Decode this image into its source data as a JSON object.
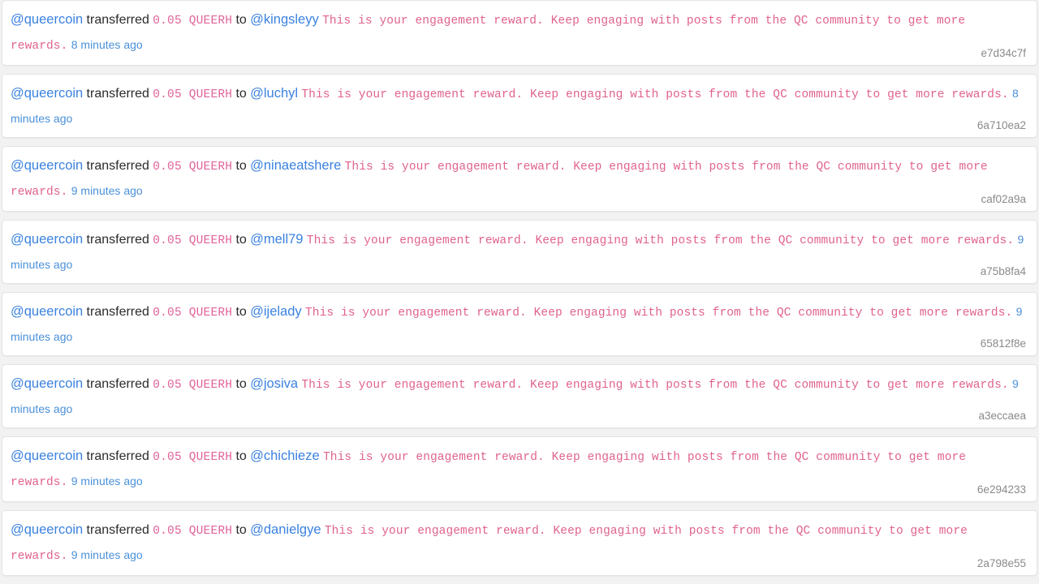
{
  "feed": {
    "sender": "@queercoin",
    "verb_transferred": "transferred",
    "verb_to": "to",
    "amount": "0.05 QUEERH",
    "memo": "This is your engagement reward. Keep engaging with posts from the QC community to get more rewards.",
    "colors": {
      "link": "#3b82e0",
      "memo": "#e0628f",
      "amount": "#e0639a",
      "timestamp": "#4a90d9",
      "txid": "#8a8a8a",
      "page_background": "#f2f2f2",
      "card_background": "#ffffff"
    },
    "transactions": [
      {
        "sender": "@queercoin",
        "verb_transferred": "transferred",
        "amount": "0.05 QUEERH",
        "verb_to": "to",
        "recipient": "@kingsleyy",
        "memo": "This is your engagement reward. Keep engaging with posts from the QC community to get more rewards.",
        "timestamp": "8 minutes ago",
        "txid": "e7d34c7f"
      },
      {
        "sender": "@queercoin",
        "verb_transferred": "transferred",
        "amount": "0.05 QUEERH",
        "verb_to": "to",
        "recipient": "@luchyl",
        "memo": "This is your engagement reward. Keep engaging with posts from the QC community to get more rewards.",
        "timestamp": "8 minutes ago",
        "txid": "6a710ea2"
      },
      {
        "sender": "@queercoin",
        "verb_transferred": "transferred",
        "amount": "0.05 QUEERH",
        "verb_to": "to",
        "recipient": "@ninaeatshere",
        "memo": "This is your engagement reward. Keep engaging with posts from the QC community to get more rewards.",
        "timestamp": "9 minutes ago",
        "txid": "caf02a9a"
      },
      {
        "sender": "@queercoin",
        "verb_transferred": "transferred",
        "amount": "0.05 QUEERH",
        "verb_to": "to",
        "recipient": "@mell79",
        "memo": "This is your engagement reward. Keep engaging with posts from the QC community to get more rewards.",
        "timestamp": "9 minutes ago",
        "txid": "a75b8fa4"
      },
      {
        "sender": "@queercoin",
        "verb_transferred": "transferred",
        "amount": "0.05 QUEERH",
        "verb_to": "to",
        "recipient": "@ijelady",
        "memo": "This is your engagement reward. Keep engaging with posts from the QC community to get more rewards.",
        "timestamp": "9 minutes ago",
        "txid": "65812f8e"
      },
      {
        "sender": "@queercoin",
        "verb_transferred": "transferred",
        "amount": "0.05 QUEERH",
        "verb_to": "to",
        "recipient": "@josiva",
        "memo": "This is your engagement reward. Keep engaging with posts from the QC community to get more rewards.",
        "timestamp": "9 minutes ago",
        "txid": "a3eccaea"
      },
      {
        "sender": "@queercoin",
        "verb_transferred": "transferred",
        "amount": "0.05 QUEERH",
        "verb_to": "to",
        "recipient": "@chichieze",
        "memo": "This is your engagement reward. Keep engaging with posts from the QC community to get more rewards.",
        "timestamp": "9 minutes ago",
        "txid": "6e294233"
      },
      {
        "sender": "@queercoin",
        "verb_transferred": "transferred",
        "amount": "0.05 QUEERH",
        "verb_to": "to",
        "recipient": "@danielgye",
        "memo": "This is your engagement reward. Keep engaging with posts from the QC community to get more rewards.",
        "timestamp": "9 minutes ago",
        "txid": "2a798e55"
      }
    ]
  }
}
